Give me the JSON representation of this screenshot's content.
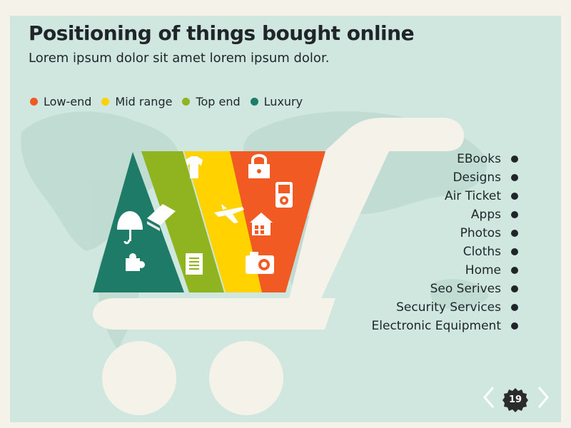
{
  "title": "Positioning of things bought online",
  "subtitle": "Lorem ipsum dolor sit amet lorem ipsum dolor.",
  "legend": [
    {
      "label": "Low-end",
      "color": "#f15a22"
    },
    {
      "label": "Mid range",
      "color": "#ffd200"
    },
    {
      "label": "Top end",
      "color": "#8fb41f"
    },
    {
      "label": "Luxury",
      "color": "#1e7b67"
    }
  ],
  "items": [
    "EBooks",
    "Designs",
    "Air Ticket",
    "Apps",
    "Photos",
    "Cloths",
    "Home",
    "Seo Serives",
    "Security Services",
    "Electronic Equipment"
  ],
  "segment_icons": {
    "luxury": [
      "umbrella-icon",
      "puzzle-icon"
    ],
    "top_end": [
      "book-icon",
      "document-icon"
    ],
    "mid_range": [
      "tshirt-icon",
      "airplane-icon"
    ],
    "low_end": [
      "lock-icon",
      "mp3-player-icon",
      "house-icon",
      "camera-icon"
    ]
  },
  "page_number": "19"
}
